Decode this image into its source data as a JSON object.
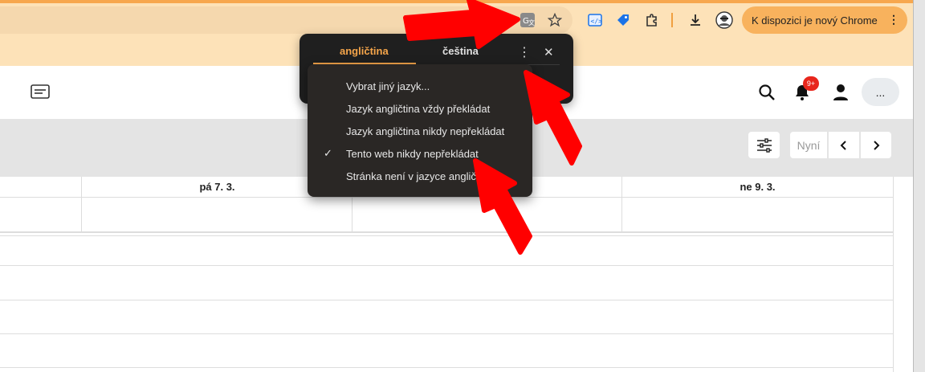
{
  "browser": {
    "update_button_label": "K dispozici je nový Chrome",
    "update_menu_glyph": "⋮",
    "icons": [
      "translate-icon",
      "star-icon",
      "devtools-extension-icon",
      "tag-extension-icon",
      "extensions-puzzle-icon",
      "download-icon",
      "profile-avatar-icon"
    ]
  },
  "app": {
    "notification_badge": "9+",
    "more_button_label": "...",
    "nav": {
      "now_label": "Nyní"
    },
    "calendar": {
      "day_headers": [
        "pá 7. 3.",
        "",
        "ne 9. 3."
      ]
    }
  },
  "translate_popup": {
    "tabs": [
      "angličtina",
      "čeština"
    ],
    "active_tab": "angličtina",
    "menu_glyph": "⋮",
    "close_glyph": "✕",
    "menu_items": [
      {
        "label": "Vybrat jiný jazyk...",
        "checked": false
      },
      {
        "label": "Jazyk angličtina vždy překládat",
        "checked": false
      },
      {
        "label": "Jazyk angličtina nikdy nepřekládat",
        "checked": false
      },
      {
        "label": "Tento web nikdy nepřekládat",
        "checked": true
      },
      {
        "label": "Stránka není v jazyce angličtina",
        "checked": false
      }
    ],
    "check_glyph": "✓"
  },
  "colors": {
    "accent_orange": "#f7a74e",
    "popup_bg": "#1f1f1f",
    "menu_bg": "#2a2725",
    "badge_red": "#e8261c",
    "arrow_red": "#ff0000"
  }
}
